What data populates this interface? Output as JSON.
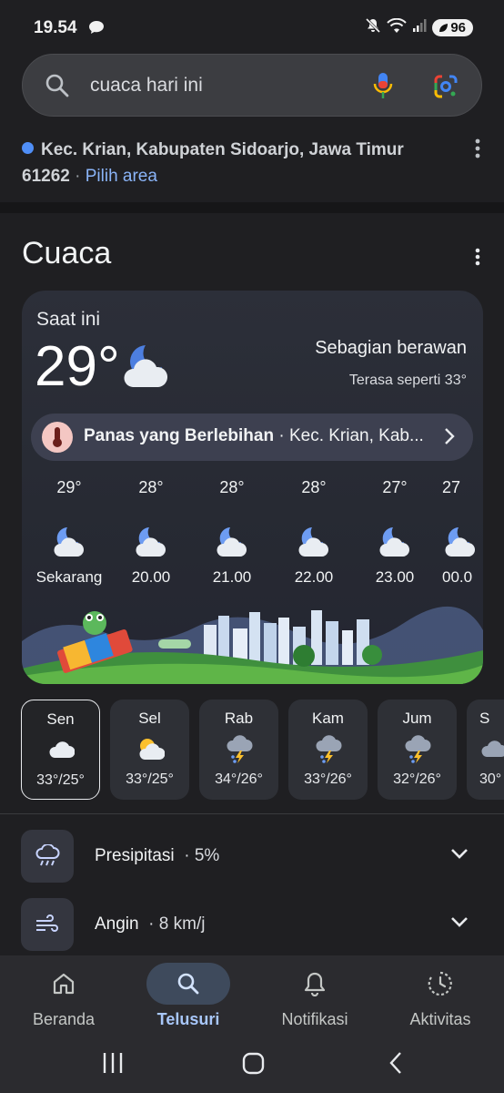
{
  "status": {
    "time": "19.54",
    "battery": "96"
  },
  "search": {
    "query": "cuaca hari ini"
  },
  "location": {
    "address": "Kec. Krian, Kabupaten Sidoarjo, Jawa Timur",
    "postal": "61262",
    "separator": "·",
    "pick_area": "Pilih area"
  },
  "weather": {
    "title": "Cuaca",
    "now_label": "Saat ini",
    "temp": "29°",
    "condition": "Sebagian berawan",
    "feels_like": "Terasa seperti 33°",
    "alert": {
      "title": "Panas yang Berlebihan",
      "detail": "· Kec. Krian, Kab..."
    },
    "hourly": [
      {
        "temp": "29°",
        "label": "Sekarang",
        "icon": "moon-cloud-icon"
      },
      {
        "temp": "28°",
        "label": "20.00",
        "icon": "moon-cloud-icon"
      },
      {
        "temp": "28°",
        "label": "21.00",
        "icon": "moon-cloud-icon"
      },
      {
        "temp": "28°",
        "label": "22.00",
        "icon": "moon-cloud-icon"
      },
      {
        "temp": "27°",
        "label": "23.00",
        "icon": "moon-cloud-icon"
      },
      {
        "temp": "27",
        "label": "00.0",
        "icon": "moon-cloud-icon"
      }
    ],
    "daily": [
      {
        "day": "Sen",
        "range": "33°/25°",
        "icon": "cloud-icon"
      },
      {
        "day": "Sel",
        "range": "33°/25°",
        "icon": "sun-cloud-icon"
      },
      {
        "day": "Rab",
        "range": "34°/26°",
        "icon": "thunderstorm-icon"
      },
      {
        "day": "Kam",
        "range": "33°/26°",
        "icon": "thunderstorm-icon"
      },
      {
        "day": "Jum",
        "range": "32°/26°",
        "icon": "thunderstorm-icon"
      },
      {
        "day": "S",
        "range": "30°",
        "icon": "cloud-icon"
      }
    ],
    "precip": {
      "label": "Presipitasi",
      "value": "·  5%"
    },
    "wind": {
      "label": "Angin",
      "value": "·  8 km/j"
    }
  },
  "nav": {
    "home": "Beranda",
    "search": "Telusuri",
    "notifications": "Notifikasi",
    "activity": "Aktivitas"
  }
}
